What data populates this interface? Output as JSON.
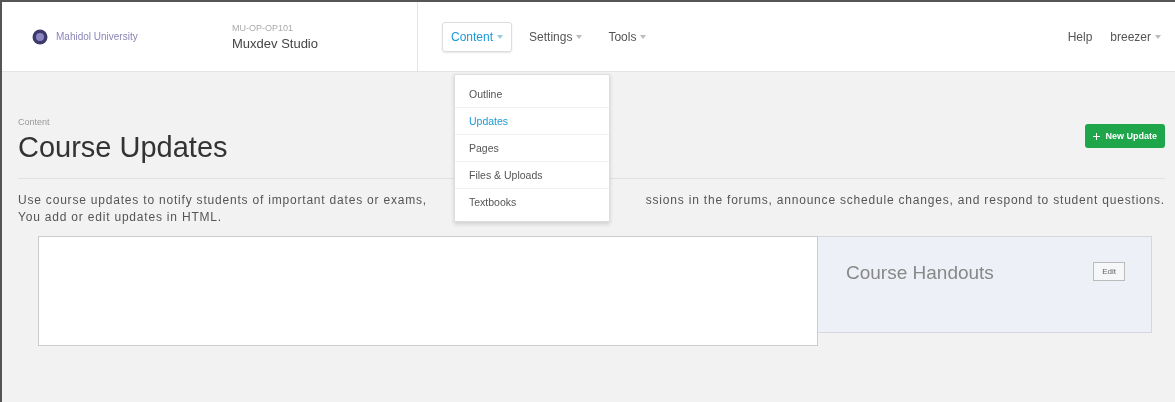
{
  "header": {
    "org_name": "Mahidol University",
    "course_code": "MU-OP-OP101",
    "course_name": "Muxdev Studio"
  },
  "nav": [
    {
      "label": "Content",
      "selected": true
    },
    {
      "label": "Settings",
      "selected": false
    },
    {
      "label": "Tools",
      "selected": false
    }
  ],
  "user_nav": [
    {
      "label": "Help",
      "kind": "link"
    },
    {
      "label": "breezer",
      "kind": "menu"
    }
  ],
  "dropdown": {
    "items": [
      {
        "label": "Outline",
        "selected": false
      },
      {
        "label": "Updates",
        "selected": true
      },
      {
        "label": "Pages",
        "selected": false
      },
      {
        "label": "Files & Uploads",
        "selected": false
      },
      {
        "label": "Textbooks",
        "selected": false
      }
    ]
  },
  "page": {
    "breadcrumb": "Content",
    "title": "Course Updates",
    "new_button": "New Update",
    "description_left": "Use course updates to notify students of important dates or exams,",
    "description_right": "ssions in the forums, announce schedule changes, and respond to student questions.",
    "description_line_2": "You add or edit updates in HTML."
  },
  "handouts": {
    "title": "Course Handouts",
    "edit_button": "Edit"
  }
}
